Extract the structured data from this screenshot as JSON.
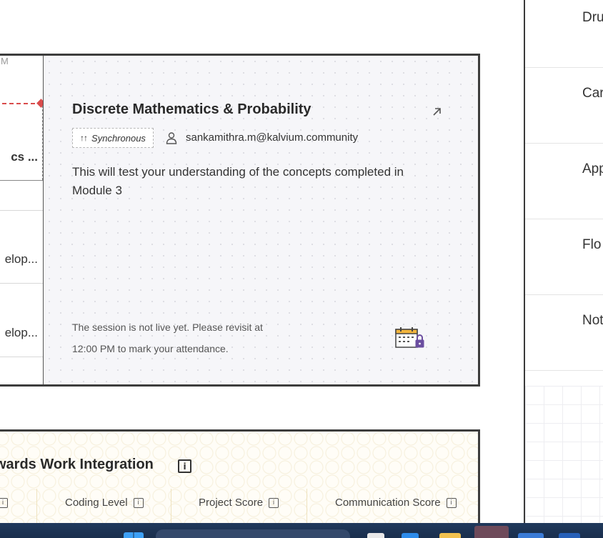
{
  "session": {
    "left_list": {
      "time_fragment": "M",
      "active_item": "cs ...",
      "items": [
        "elop...",
        "elop..."
      ]
    },
    "title": "Discrete Mathematics & Probability",
    "mode_icon": "up-arrows-icon",
    "mode": "Synchronous",
    "instructor_email": "sankamithra.m@kalvium.community",
    "description": "This will test your understanding of the concepts completed in Module 3",
    "notice_line1": "The session is not live yet. Please revisit at",
    "notice_line2": "12:00 PM to mark your attendance.",
    "status_icon": "calendar-locked-icon"
  },
  "right_panel": {
    "items": [
      "Dru",
      "Car",
      "App",
      "Flo",
      "Not"
    ]
  },
  "work_integration": {
    "title": "wards Work Integration",
    "metrics": [
      "Coding Level",
      "Project Score",
      "Communication Score"
    ]
  },
  "colors": {
    "accent_red": "#d94b4b",
    "detail_bg": "#f6f6f9",
    "border_dark": "#3d3d3d",
    "lock_purple": "#6b4ea0",
    "taskbar": "#1d3557"
  }
}
